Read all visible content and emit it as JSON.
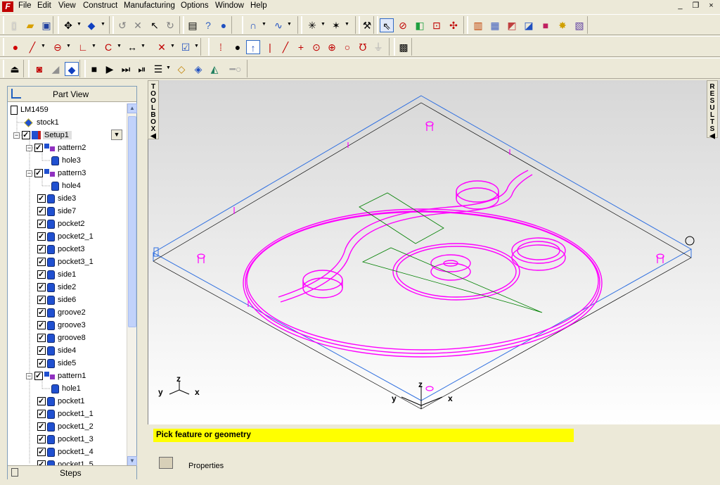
{
  "menubar": {
    "items": [
      "File",
      "Edit",
      "View",
      "Construct",
      "Manufacturing",
      "Options",
      "Window",
      "Help"
    ],
    "window_controls": [
      "_",
      "❐",
      "×"
    ]
  },
  "part_view": {
    "title": "Part View",
    "tree": [
      {
        "label": "LM1459",
        "type": "document",
        "depth": 0
      },
      {
        "label": "stock1",
        "type": "stock",
        "depth": 1
      },
      {
        "label": "Setup1",
        "type": "setup",
        "depth": 1,
        "expanded": true,
        "checked": true,
        "selected": true
      },
      {
        "label": "pattern2",
        "type": "pattern",
        "depth": 2,
        "expanded": true,
        "checked": true
      },
      {
        "label": "hole3",
        "type": "feature",
        "depth": 3
      },
      {
        "label": "pattern3",
        "type": "pattern",
        "depth": 2,
        "expanded": true,
        "checked": true
      },
      {
        "label": "hole4",
        "type": "feature",
        "depth": 3
      },
      {
        "label": "side3",
        "type": "feature",
        "depth": 2,
        "checked": true
      },
      {
        "label": "side7",
        "type": "feature",
        "depth": 2,
        "checked": true
      },
      {
        "label": "pocket2",
        "type": "feature",
        "depth": 2,
        "checked": true
      },
      {
        "label": "pocket2_1",
        "type": "feature",
        "depth": 2,
        "checked": true
      },
      {
        "label": "pocket3",
        "type": "feature",
        "depth": 2,
        "checked": true
      },
      {
        "label": "pocket3_1",
        "type": "feature",
        "depth": 2,
        "checked": true
      },
      {
        "label": "side1",
        "type": "feature",
        "depth": 2,
        "checked": true
      },
      {
        "label": "side2",
        "type": "feature",
        "depth": 2,
        "checked": true
      },
      {
        "label": "side6",
        "type": "feature",
        "depth": 2,
        "checked": true
      },
      {
        "label": "groove2",
        "type": "feature",
        "depth": 2,
        "checked": true
      },
      {
        "label": "groove3",
        "type": "feature",
        "depth": 2,
        "checked": true
      },
      {
        "label": "groove8",
        "type": "feature",
        "depth": 2,
        "checked": true
      },
      {
        "label": "side4",
        "type": "feature",
        "depth": 2,
        "checked": true
      },
      {
        "label": "side5",
        "type": "feature",
        "depth": 2,
        "checked": true
      },
      {
        "label": "pattern1",
        "type": "pattern",
        "depth": 2,
        "expanded": true,
        "checked": true
      },
      {
        "label": "hole1",
        "type": "feature",
        "depth": 3
      },
      {
        "label": "pocket1",
        "type": "feature",
        "depth": 2,
        "checked": true
      },
      {
        "label": "pocket1_1",
        "type": "feature",
        "depth": 2,
        "checked": true
      },
      {
        "label": "pocket1_2",
        "type": "feature",
        "depth": 2,
        "checked": true
      },
      {
        "label": "pocket1_3",
        "type": "feature",
        "depth": 2,
        "checked": true
      },
      {
        "label": "pocket1_4",
        "type": "feature",
        "depth": 2,
        "checked": true
      },
      {
        "label": "pocket1_5",
        "type": "feature",
        "depth": 2,
        "checked": true
      }
    ],
    "steps_label": "Steps"
  },
  "side_tabs": {
    "toolbox": "TOOLBOX",
    "results": "RESULTS"
  },
  "viewport": {
    "axis_small": {
      "x": "x",
      "y": "y",
      "z": "z"
    },
    "axis_origin": {
      "x": "x",
      "y": "y",
      "z": "z"
    }
  },
  "status": {
    "prompt": "Pick feature or geometry"
  },
  "properties": {
    "label": "Properties"
  },
  "colors": {
    "geometry": "#ff00ff",
    "stock_outline": "#3070e0",
    "sketch": "#008000",
    "status_bg": "#ffff00"
  }
}
